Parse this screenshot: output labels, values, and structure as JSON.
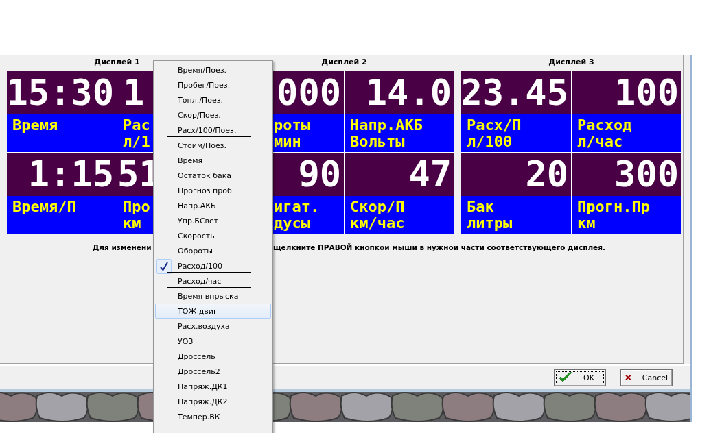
{
  "displays": [
    {
      "title": "Дисплей 1",
      "cells": [
        {
          "value": "15:30",
          "label": [
            "Время"
          ]
        },
        {
          "value": "1",
          "label": [
            "Рас",
            "л/1"
          ]
        },
        {
          "value": "1:15",
          "label": [
            "Время/П"
          ]
        },
        {
          "value": "51",
          "label": [
            "Про",
            "км"
          ]
        }
      ]
    },
    {
      "title": "Дисплей 2",
      "cells": [
        {
          "value": "000",
          "label": [
            "роты",
            "мин"
          ]
        },
        {
          "value": "14.0",
          "label": [
            "Напр.АКБ",
            "Вольты"
          ]
        },
        {
          "value": "90",
          "label": [
            "игат.",
            "дусы"
          ]
        },
        {
          "value": "47",
          "label": [
            "Скор/П",
            "км/час"
          ]
        }
      ]
    },
    {
      "title": "Дисплей 3",
      "cells": [
        {
          "value": "23.45",
          "label": [
            "Расх/П",
            "л/100"
          ]
        },
        {
          "value": "100",
          "label": [
            "Расход",
            "л/час"
          ]
        },
        {
          "value": "20",
          "label": [
            "Бак",
            "литры"
          ]
        },
        {
          "value": "300",
          "label": [
            "Прогн.Пр",
            "км"
          ]
        }
      ]
    }
  ],
  "hint_left": "Для изменени",
  "hint_right": "щелкните ПРАВОЙ кнопкой мыши в нужной части соответствующего дисплея.",
  "buttons": [
    {
      "kind": "ok",
      "label": "OK",
      "focused": true
    },
    {
      "kind": "cancel",
      "label": "Cancel",
      "focused": false
    }
  ],
  "menu": [
    {
      "label": "Время/Поез.",
      "checked": false,
      "selected": false,
      "rule_below": false
    },
    {
      "label": "Пробег/Поез.",
      "checked": false,
      "selected": false,
      "rule_below": false
    },
    {
      "label": "Топл./Поез.",
      "checked": false,
      "selected": false,
      "rule_below": false
    },
    {
      "label": "Скор/Поез.",
      "checked": false,
      "selected": false,
      "rule_below": false
    },
    {
      "label": "Расх/100/Поез.",
      "checked": false,
      "selected": false,
      "rule_below": true
    },
    {
      "label": "Стоим/Поез.",
      "checked": false,
      "selected": false,
      "rule_below": false
    },
    {
      "label": "Время",
      "checked": false,
      "selected": false,
      "rule_below": false
    },
    {
      "label": "Остаток бака",
      "checked": false,
      "selected": false,
      "rule_below": false
    },
    {
      "label": "Прогноз проб",
      "checked": false,
      "selected": false,
      "rule_below": false
    },
    {
      "label": "Напр.АКБ",
      "checked": false,
      "selected": false,
      "rule_below": false
    },
    {
      "label": "Упр.БСвет",
      "checked": false,
      "selected": false,
      "rule_below": false
    },
    {
      "label": "Скорость",
      "checked": false,
      "selected": false,
      "rule_below": false
    },
    {
      "label": "Обороты",
      "checked": false,
      "selected": false,
      "rule_below": false
    },
    {
      "label": "Расход/100",
      "checked": true,
      "selected": false,
      "rule_below": true
    },
    {
      "label": "Расход/час",
      "checked": false,
      "selected": false,
      "rule_below": true
    },
    {
      "label": "Время впрыска",
      "checked": false,
      "selected": false,
      "rule_below": false
    },
    {
      "label": "ТОЖ двиг",
      "checked": false,
      "selected": true,
      "rule_below": false
    },
    {
      "label": "Расх.воздуха",
      "checked": false,
      "selected": false,
      "rule_below": false
    },
    {
      "label": "УОЗ",
      "checked": false,
      "selected": false,
      "rule_below": false
    },
    {
      "label": "Дроссель",
      "checked": false,
      "selected": false,
      "rule_below": false
    },
    {
      "label": "Дроссель2",
      "checked": false,
      "selected": false,
      "rule_below": false
    },
    {
      "label": "Напряж.ДК1",
      "checked": false,
      "selected": false,
      "rule_below": false
    },
    {
      "label": "Напряж.ДК2",
      "checked": false,
      "selected": false,
      "rule_below": false
    },
    {
      "label": "Темпер.ВК",
      "checked": false,
      "selected": false,
      "rule_below": false
    }
  ]
}
